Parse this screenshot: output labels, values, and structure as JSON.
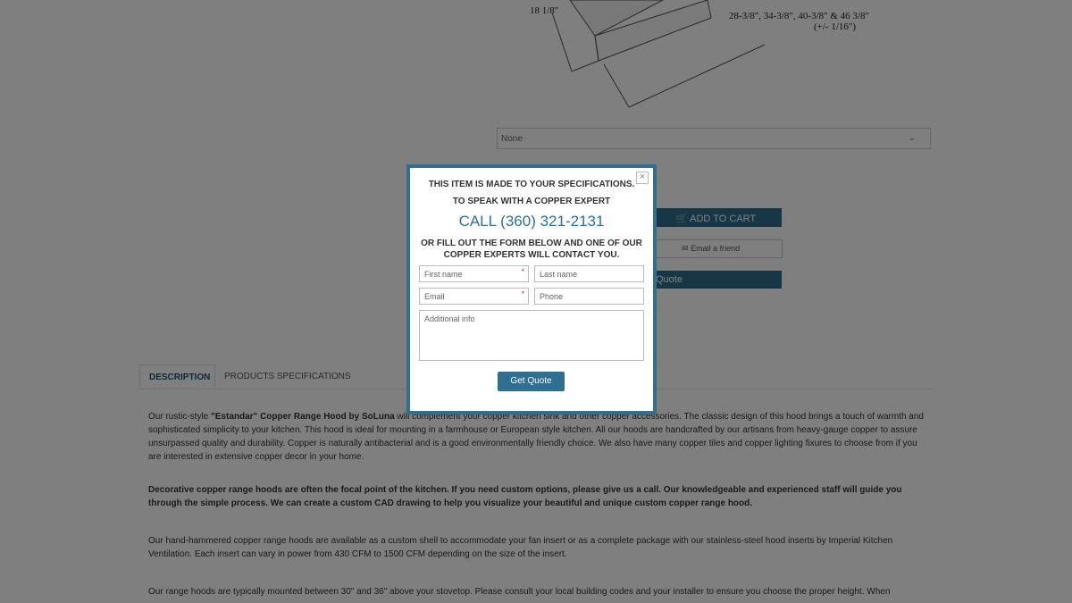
{
  "drawing": {
    "dim_left": "18 1/8\"",
    "dim_sizes": "28-3/8\", 34-3/8\", 40-3/8\" & 46 3/8\"",
    "dim_tolerance": "(+/- 1/16\")"
  },
  "select": {
    "value": "None"
  },
  "actions": {
    "add_to_cart": "ADD TO CART",
    "email_friend": "Email a friend",
    "quote_partial": "Quote"
  },
  "tabs": [
    {
      "label": "DESCRIPTION"
    },
    {
      "label": "PRODUCTS SPECIFICATIONS"
    }
  ],
  "description": {
    "p1_pre": "Our rustic-style ",
    "p1_bold": "\"Estandar\" Copper Range Hood by SoLuna",
    "p1_post": " will complement your copper kitchen sink and other copper accessories.  The classic design of this hood brings a touch of warmth and sophisticated simplicity to your kitchen.  This hood is ideal for mounting in a farmhouse or European style kitchen.  All our hoods are handcrafted by our artisans from heavy-gauge copper to assure unsurpassed quality and durability.  Copper is naturally antibacterial and is a good environmentally friendly choice.  We also have many copper tiles and copper lighting fixures to choose from if you are interested in extensive copper decor in your home.",
    "p2": "Decorative copper range hoods are often the focal point of the kitchen. If you need custom options, please give us a call. Our knowledgeable and experienced staff will guide you through the simple process. We can create a custom CAD drawing to help you visualize your beautiful and unique custom copper range hood.",
    "p3": "Our hand-hammered copper range hoods are available as a custom shell to accommodate your fan insert or as a complete package with our stainless-steel hood inserts by Imperial Kitchen Ventilation. Each insert can vary in power from 430 CFM to 1500 CFM depending on the size of the insert.",
    "p4": "Our range hoods are typically mounted between 30\" and 36\" above your stovetop. Please consult your local building codes and your installer to ensure you choose the proper height. When"
  },
  "modal": {
    "heading1": "THIS ITEM IS MADE TO YOUR SPECIFICATIONS.",
    "heading2": "TO SPEAK WITH A COPPER EXPERT",
    "call": "CALL (360) 321-2131",
    "heading3": "OR FILL OUT THE FORM BELOW AND ONE OF OUR COPPER EXPERTS WILL CONTACT YOU.",
    "first_name_placeholder": "First name",
    "last_name_placeholder": "Last name",
    "email_placeholder": "Email",
    "phone_placeholder": "Phone",
    "info_placeholder": "Additional info",
    "required_mark": "*",
    "submit": "Get Quote",
    "close": "×"
  },
  "colors": {
    "accent": "#2f6f8f",
    "call": "#2f6f9a",
    "overlay": "rgba(0,0,0,0.5)"
  },
  "icons": {
    "cart": "cart-icon",
    "email": "envelope-icon",
    "select": "chevron-down-icon",
    "close": "close-icon"
  }
}
